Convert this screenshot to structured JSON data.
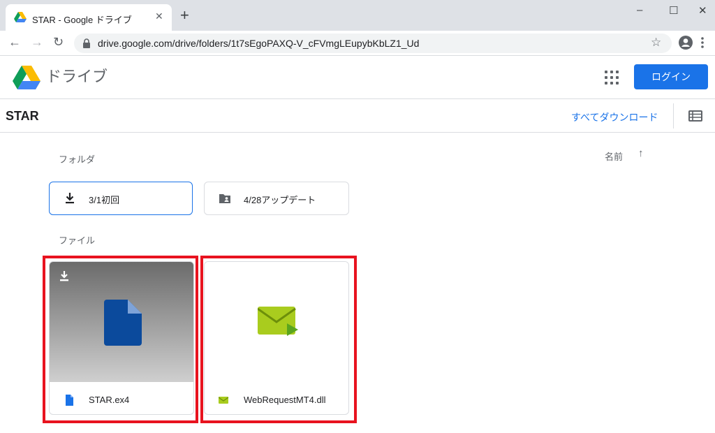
{
  "browser": {
    "tab_title": "STAR - Google ドライブ",
    "tab_close": "✕",
    "new_tab": "+",
    "url": "drive.google.com/drive/folders/1t7sEgoPAXQ-V_cFVmgLEupybKbLZ1_Ud",
    "window_controls": [
      "–",
      "☐",
      "✕"
    ],
    "nav": {
      "back": "←",
      "forward": "→",
      "reload": "↻"
    },
    "bookmark_star": "☆"
  },
  "drive": {
    "brand": "ドライブ",
    "login_label": "ログイン",
    "folder_title": "STAR",
    "download_all_label": "すべてダウンロード",
    "folders_section": "フォルダ",
    "files_section": "ファイル",
    "sort_label": "名前",
    "sort_arrow": "↑",
    "folders": [
      {
        "name": "3/1初回",
        "icon": "download-icon",
        "selected": true
      },
      {
        "name": "4/28アップデート",
        "icon": "shared-folder-icon",
        "selected": false
      }
    ],
    "files": [
      {
        "name": "STAR.ex4",
        "icon": "file-icon"
      },
      {
        "name": "WebRequestMT4.dll",
        "icon": "message-file-icon"
      }
    ]
  },
  "colors": {
    "accent": "#1a73e8",
    "highlight": "#e8131f",
    "file_icon": "#0b4a9c",
    "dll_icon": "#a9cc1e"
  }
}
